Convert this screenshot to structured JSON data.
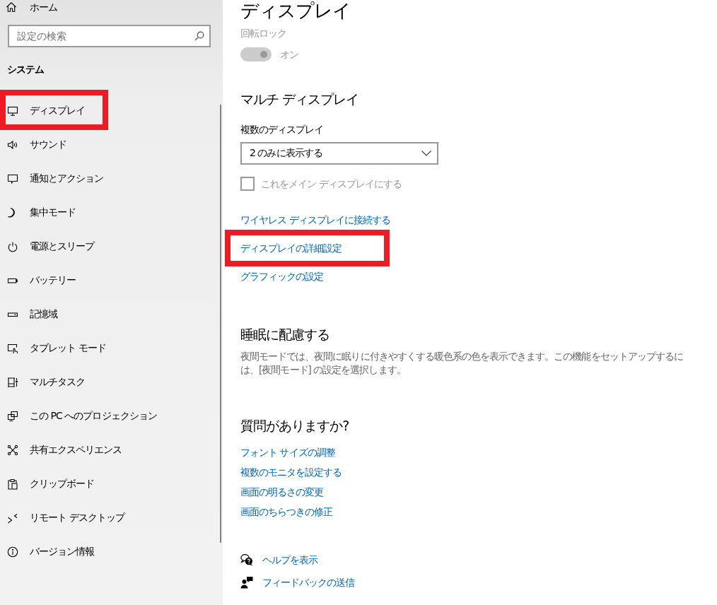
{
  "sidebar": {
    "home": {
      "label": "ホーム"
    },
    "search": {
      "placeholder": "設定の検索"
    },
    "section_title": "システム",
    "items": [
      {
        "label": "ディスプレイ",
        "highlighted": true
      },
      {
        "label": "サウンド",
        "highlighted": false
      },
      {
        "label": "通知とアクション",
        "highlighted": false
      },
      {
        "label": "集中モード",
        "highlighted": false
      },
      {
        "label": "電源とスリープ",
        "highlighted": false
      },
      {
        "label": "バッテリー",
        "highlighted": false
      },
      {
        "label": "記憶域",
        "highlighted": false
      },
      {
        "label": "タブレット モード",
        "highlighted": false
      },
      {
        "label": "マルチタスク",
        "highlighted": false
      },
      {
        "label": "この PC へのプロジェクション",
        "highlighted": false
      },
      {
        "label": "共有エクスペリエンス",
        "highlighted": false
      },
      {
        "label": "クリップボード",
        "highlighted": false
      },
      {
        "label": "リモート デスクトップ",
        "highlighted": false
      },
      {
        "label": "バージョン情報",
        "highlighted": false
      }
    ]
  },
  "main": {
    "title": "ディスプレイ",
    "rotation_lock": {
      "label": "回転ロック",
      "on": true,
      "disabled": true,
      "state_text": "オン"
    },
    "multi_display": {
      "heading": "マルチ ディスプレイ",
      "dropdown": {
        "label": "複数のディスプレイ",
        "value": "2 のみに表示する"
      },
      "checkbox": {
        "label": "これをメイン ディスプレイにする",
        "checked": false,
        "disabled": true
      },
      "links": [
        {
          "label": "ワイヤレス ディスプレイに接続する",
          "highlighted": false
        },
        {
          "label": "ディスプレイの詳細設定",
          "highlighted": true
        },
        {
          "label": "グラフィックの設定",
          "highlighted": false
        }
      ]
    },
    "night_light": {
      "heading": "睡眠に配慮する",
      "description": "夜間モードでは、夜間に眠りに付きやすくする暖色系の色を表示できます。この機能をセットアップするには、[夜間モード] の設定を選択します。"
    },
    "questions": {
      "heading": "質問がありますか?",
      "links": [
        {
          "label": "フォント サイズの調整"
        },
        {
          "label": "複数のモニタを設定する"
        },
        {
          "label": "画面の明るさの変更"
        },
        {
          "label": "画面のちらつきの修正"
        }
      ]
    },
    "footer_links": [
      {
        "label": "ヘルプを表示"
      },
      {
        "label": "フィードバックの送信"
      }
    ]
  }
}
